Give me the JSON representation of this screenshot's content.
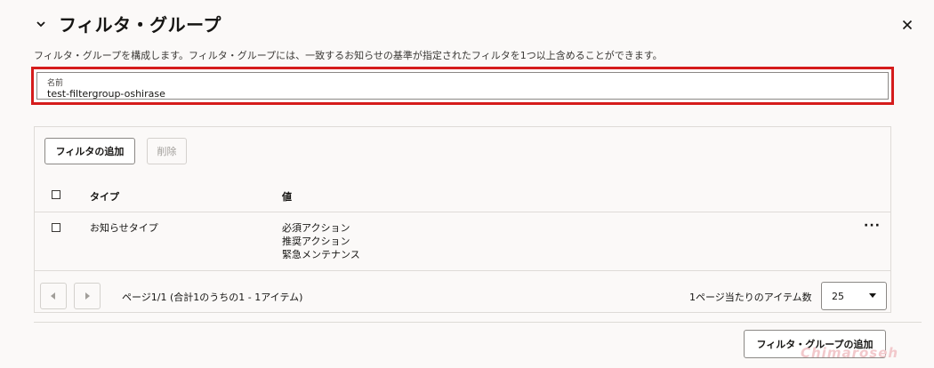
{
  "header": {
    "title": "フィルタ・グループ",
    "description": "フィルタ・グループを構成します。フィルタ・グループには、一致するお知らせの基準が指定されたフィルタを1つ以上含めることができます。"
  },
  "name_field": {
    "label": "名前",
    "value": "test-filtergroup-oshirase"
  },
  "toolbar": {
    "add_filter_label": "フィルタの追加",
    "delete_label": "削除"
  },
  "table": {
    "columns": [
      "タイプ",
      "値"
    ],
    "rows": [
      {
        "type": "お知らせタイプ",
        "values": [
          "必須アクション",
          "推奨アクション",
          "緊急メンテナンス"
        ]
      }
    ],
    "row_menu": "···"
  },
  "pagination": {
    "summary": "ページ1/1 (合計1のうちの1 - 1アイテム)",
    "items_per_page_label": "1ページ当たりのアイテム数",
    "items_per_page": "25"
  },
  "footer": {
    "add_group_label": "フィルタ・グループの追加"
  },
  "watermark": "Chimaroseh"
}
